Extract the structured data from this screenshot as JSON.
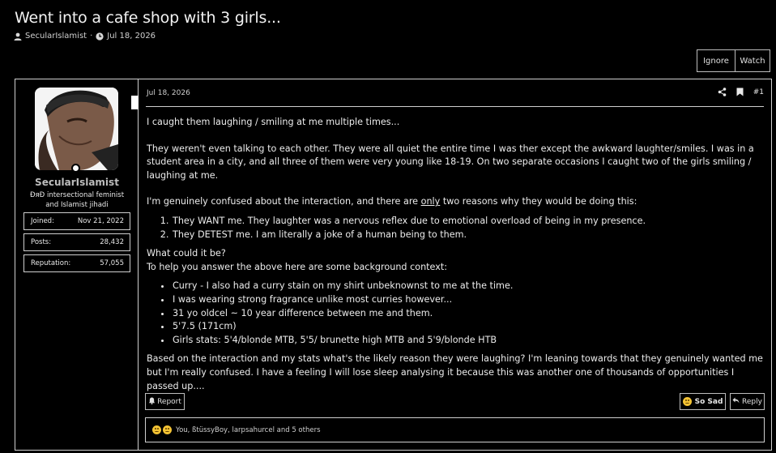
{
  "thread": {
    "title": "Went into a cafe shop with 3 girls...",
    "author": "SecularIslamist",
    "separator": "·",
    "date": "Jul 18, 2026"
  },
  "top_buttons": {
    "ignore": "Ignore",
    "watch": "Watch"
  },
  "user": {
    "name": "SecularIslamist",
    "title": "ÐяÐ intersectional feminist and Islamist jihadi",
    "stats": [
      {
        "label": "Joined:",
        "value": "Nov 21, 2022"
      },
      {
        "label": "Posts:",
        "value": "28,432"
      },
      {
        "label": "Reputation:",
        "value": "57,055"
      }
    ]
  },
  "post": {
    "date": "Jul 18, 2026",
    "number": "#1",
    "p1": "I caught them laughing / smiling at me multiple times...",
    "p2": "They weren't even talking to each other. They were all quiet the entire time I was ther except the awkward laughter/smiles. I was in a student area in a city, and all three of them were very young like 18-19. On two separate occasions I caught two of the girls smiling / laughing at me.",
    "p3_before": "I'm genuinely confused about the interaction, and there are ",
    "p3_underline": "only",
    "p3_after": " two reasons why they would be doing this:",
    "reasons": [
      "They WANT me. They laughter was a nervous reflex due to emotional overload of being in my presence.",
      "They DETEST me. I am literally a joke of a human being to them."
    ],
    "p4": "What could it be?",
    "p5": "To help you answer the above here are some background context:",
    "bullets": [
      "Curry - I also had a curry stain on my shirt unbeknownst to me at the time.",
      "I was wearing strong fragrance unlike most curries however...",
      "31 yo oldcel ~ 10 year difference between me and them.",
      "5'7.5 (171cm)",
      "Girls stats: 5'4/blonde MTB, 5'5/ brunette high MTB and 5'9/blonde HTB"
    ],
    "p6": "Based on the interaction and my stats what's the likely reason they were laughing? I'm leaning towards that they genuinely wanted me but I'm really confused. I have a feeling I will lose sleep analysing it because this was another one of thousands of opportunities I passed up...."
  },
  "actions": {
    "report": "Report",
    "so_sad": "So Sad",
    "reply": "Reply"
  },
  "reactions": {
    "text": "You, ßtüssyBoy, larpsahurcel and 5 others"
  }
}
